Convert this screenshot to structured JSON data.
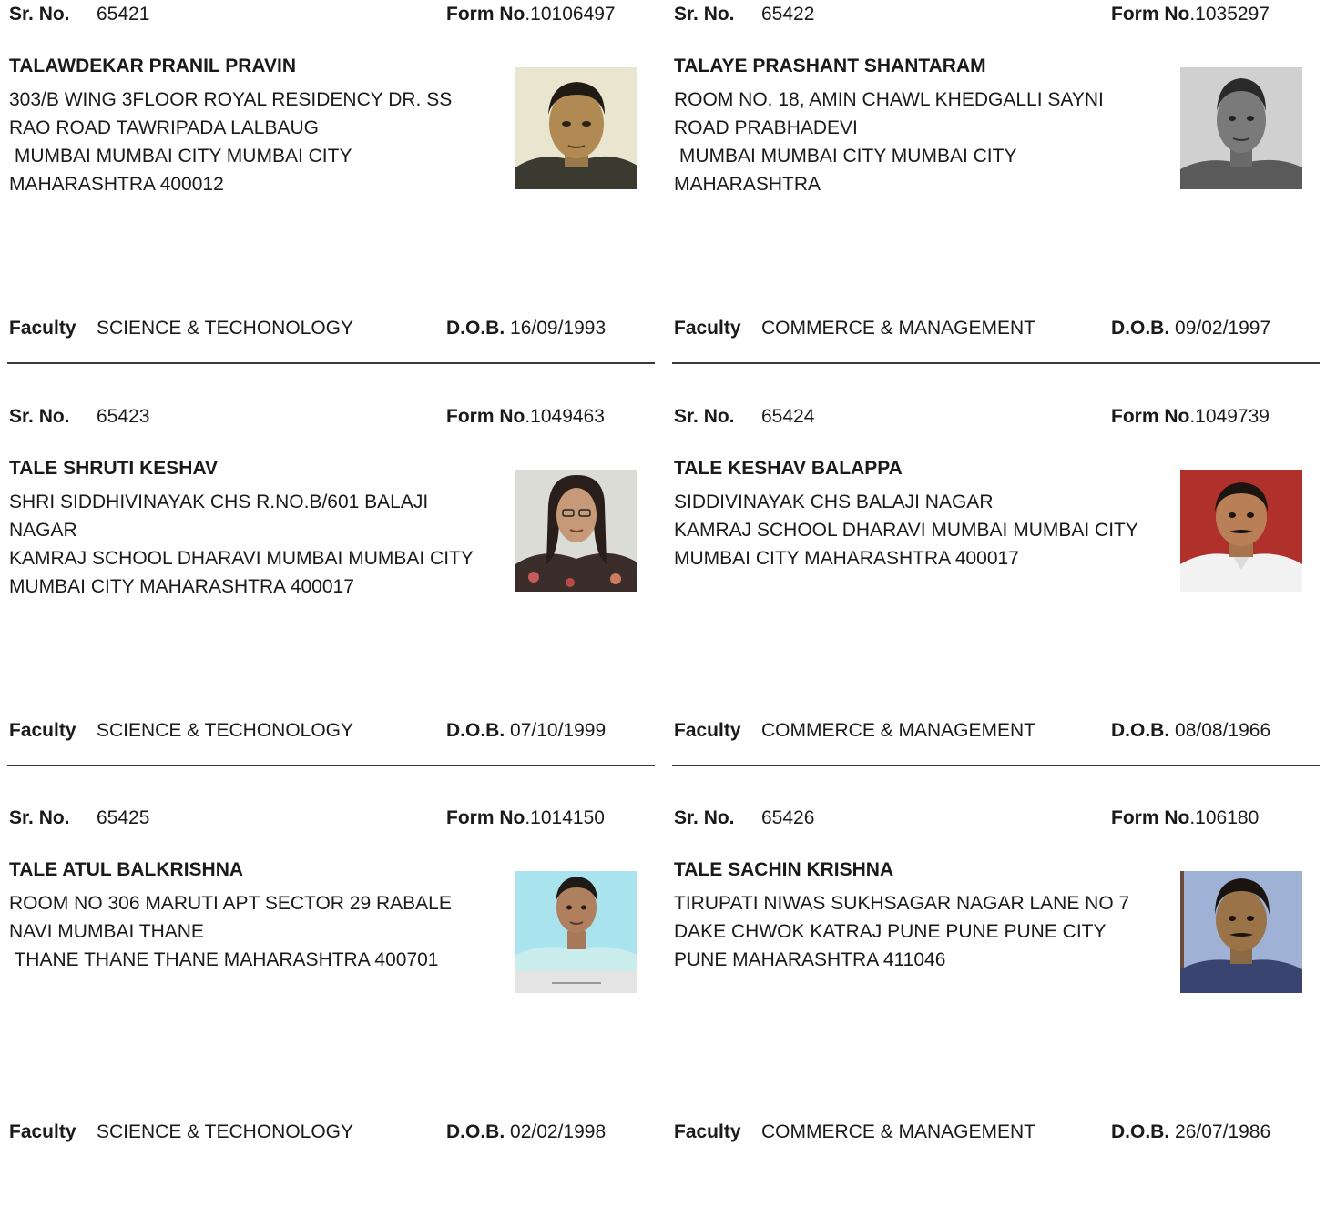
{
  "labels": {
    "sr_no": "Sr. No.",
    "form_no": "Form No",
    "form_no_dot": ".",
    "faculty": "Faculty",
    "dob": "D.O.B."
  },
  "records": [
    {
      "sr_no": "65421",
      "form_no": "10106497",
      "name": "TALAWDEKAR PRANIL PRAVIN",
      "address": [
        "303/B WING 3FLOOR ROYAL RESIDENCY DR. SS",
        "RAO ROAD TAWRIPADA LALBAUG",
        " MUMBAI MUMBAI CITY MUMBAI CITY",
        "MAHARASHTRA 400012"
      ],
      "faculty": "SCIENCE & TECHONOLOGY",
      "dob": "16/09/1993",
      "photo_bg": "#e9e5cf"
    },
    {
      "sr_no": "65422",
      "form_no": "1035297",
      "name": "TALAYE PRASHANT SHANTARAM",
      "address": [
        "ROOM NO. 18, AMIN CHAWL KHEDGALLI SAYNI",
        "ROAD PRABHADEVI",
        " MUMBAI MUMBAI CITY MUMBAI CITY",
        "MAHARASHTRA"
      ],
      "faculty": "COMMERCE & MANAGEMENT",
      "dob": "09/02/1997",
      "photo_bg": "#cfcfcf"
    },
    {
      "sr_no": "65423",
      "form_no": "1049463",
      "name": "TALE SHRUTI KESHAV",
      "address": [
        "SHRI SIDDHIVINAYAK CHS R.NO.B/601 BALAJI",
        "NAGAR",
        "KAMRAJ SCHOOL DHARAVI MUMBAI MUMBAI CITY",
        "MUMBAI CITY MAHARASHTRA 400017"
      ],
      "faculty": "SCIENCE & TECHONOLOGY",
      "dob": "07/10/1999",
      "photo_bg": "#dcdcd6"
    },
    {
      "sr_no": "65424",
      "form_no": "1049739",
      "name": "TALE KESHAV BALAPPA",
      "address": [
        "SIDDIVINAYAK CHS BALAJI NAGAR",
        "KAMRAJ SCHOOL DHARAVI MUMBAI MUMBAI CITY",
        "MUMBAI CITY MAHARASHTRA 400017"
      ],
      "faculty": "COMMERCE & MANAGEMENT",
      "dob": "08/08/1966",
      "photo_bg": "#b0302c"
    },
    {
      "sr_no": "65425",
      "form_no": "1014150",
      "name": "TALE ATUL BALKRISHNA",
      "address": [
        "ROOM NO 306 MARUTI APT SECTOR 29 RABALE",
        "NAVI MUMBAI THANE",
        " THANE THANE THANE MAHARASHTRA 400701"
      ],
      "faculty": "SCIENCE & TECHONOLOGY",
      "dob": "02/02/1998",
      "photo_bg": "#a9e3ee"
    },
    {
      "sr_no": "65426",
      "form_no": "106180",
      "name": "TALE SACHIN KRISHNA",
      "address": [
        "TIRUPATI NIWAS SUKHSAGAR NAGAR LANE NO 7",
        "DAKE CHWOK KATRAJ PUNE PUNE PUNE CITY",
        "PUNE MAHARASHTRA 411046"
      ],
      "faculty": "COMMERCE & MANAGEMENT",
      "dob": "26/07/1986",
      "photo_bg": "#9fb2d6"
    }
  ]
}
